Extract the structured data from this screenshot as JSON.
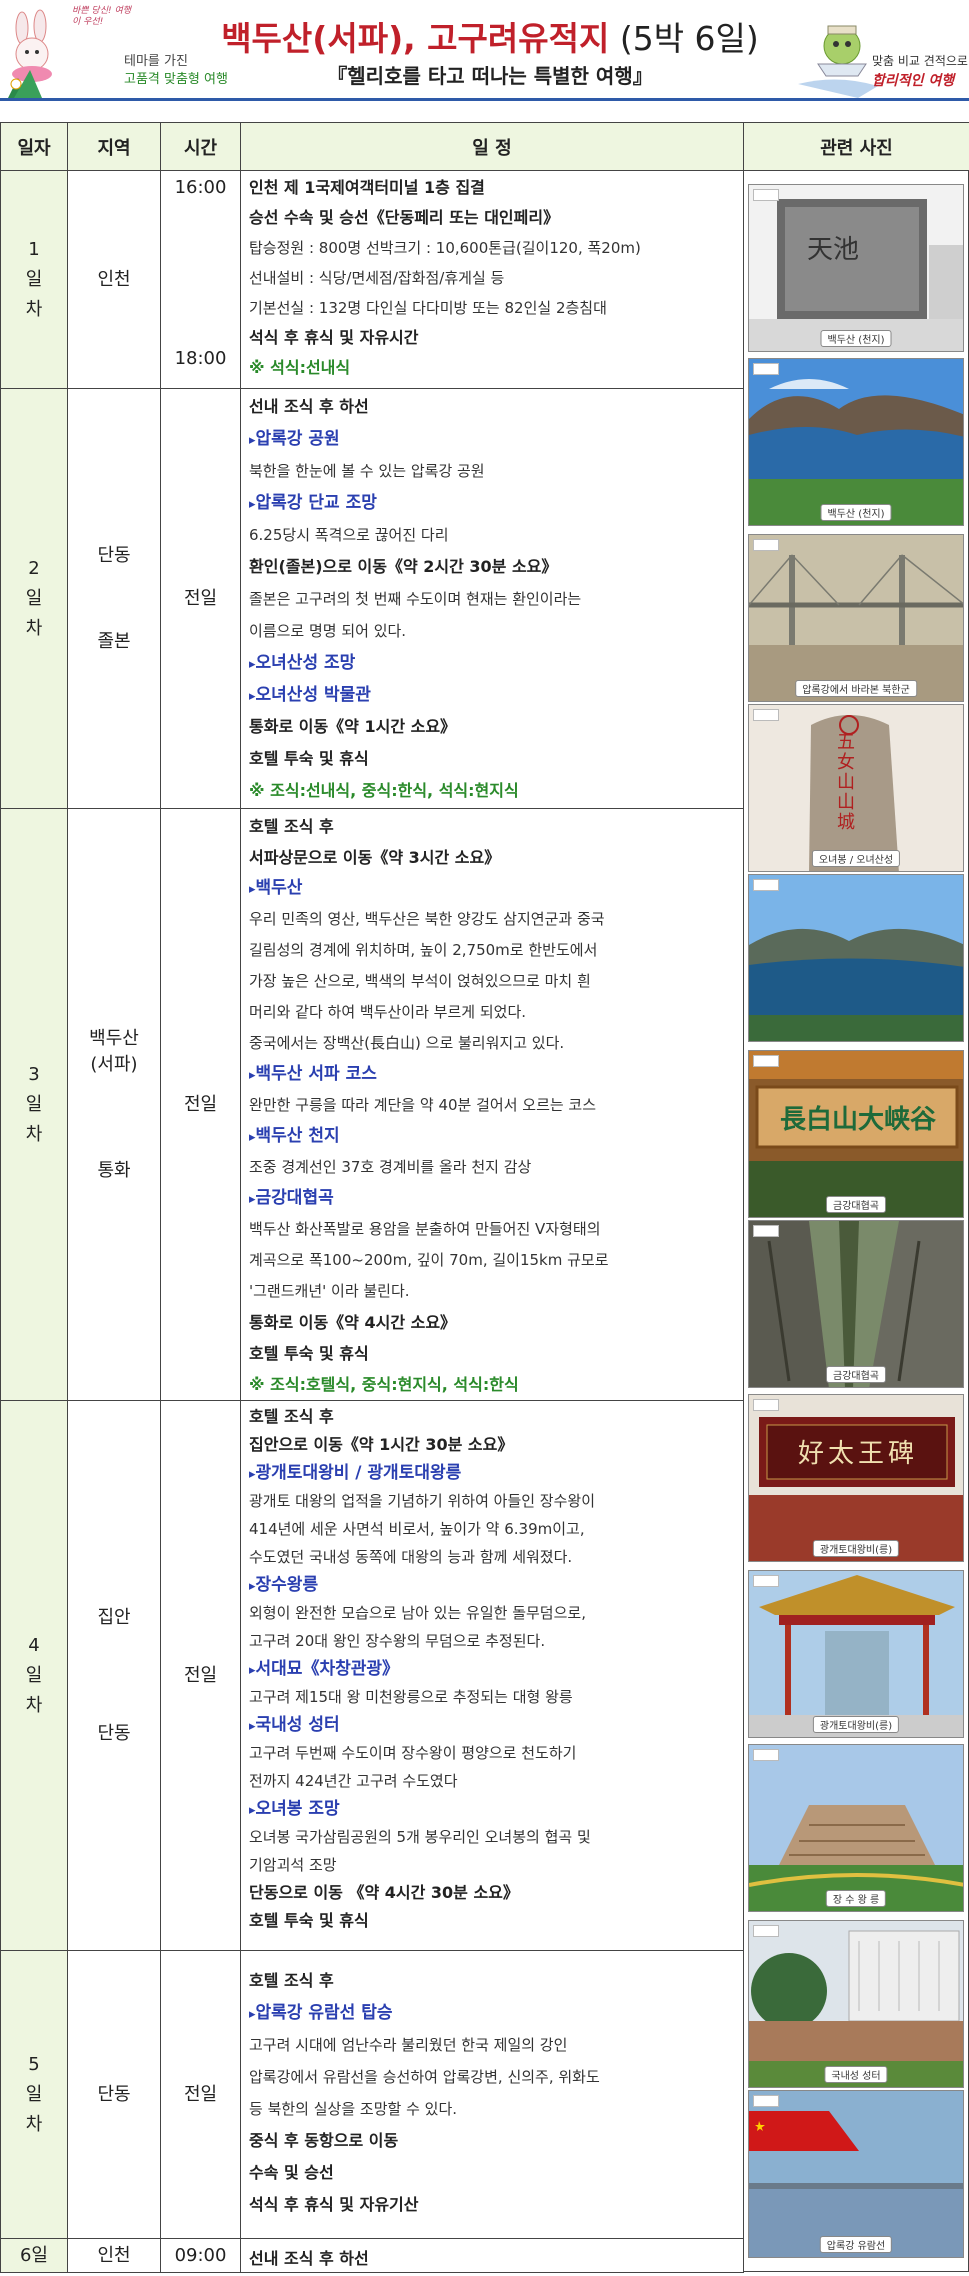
{
  "header": {
    "tagline": "바쁜 당신! 여행이 우선!",
    "left_line1": "테마를 가진",
    "left_line2": "고품격 맞춤형 여행",
    "title_red": "백두산(서파), 고구려유적지",
    "title_plain": " (5박 6일)",
    "subtitle": "『헬리호를 타고 떠나는 특별한 여행』",
    "right_line1": "맞춤 비교 견적으로",
    "right_line2": "합리적인 여행"
  },
  "columns": {
    "day": "일자",
    "region": "지역",
    "time": "시간",
    "schedule": "일          정",
    "photos": "관련 사진"
  },
  "days": [
    {
      "day": "1일차",
      "region1": "인천",
      "region2": "",
      "time1": "16:00",
      "time2": "18:00",
      "time_mid": "",
      "lines": [
        {
          "t": "b",
          "text": "인천 제 1국제여객터미널 1층 집결"
        },
        {
          "t": "b",
          "text": "승선 수속 및 승선《단동페리 또는 대인페리》"
        },
        {
          "t": "n",
          "text": "탑승정원 : 800명 선박크기 : 10,600톤급(길이120, 폭20m)"
        },
        {
          "t": "n",
          "text": "선내설비 : 식당/면세점/잡화점/휴게실 등"
        },
        {
          "t": "n",
          "text": "기본선실 : 132명 다인실 다다미방 또는 82인실 2층침대"
        },
        {
          "t": "b",
          "text": "석식 후 휴식 및 자유시간"
        },
        {
          "t": "m",
          "text": "※ 석식:선내식"
        }
      ]
    },
    {
      "day": "2일차",
      "region1": "단동",
      "region2": "졸본",
      "time1": "",
      "time2": "",
      "time_mid": "전일",
      "lines": [
        {
          "t": "b",
          "text": "선내 조식 후 하선"
        },
        {
          "t": "a",
          "text": "압록강 공원"
        },
        {
          "t": "n",
          "text": "북한을 한눈에 볼 수 있는 압록강 공원"
        },
        {
          "t": "a",
          "text": "압록강 단교 조망"
        },
        {
          "t": "n",
          "text": "6.25당시 폭격으로 끊어진 다리"
        },
        {
          "t": "b",
          "text": "환인(졸본)으로 이동《약 2시간 30분 소요》"
        },
        {
          "t": "n",
          "text": "졸본은 고구려의 첫 번째 수도이며 현재는 환인이라는"
        },
        {
          "t": "n",
          "text": "이름으로 명명 되어 있다."
        },
        {
          "t": "a",
          "text": "오녀산성 조망"
        },
        {
          "t": "a",
          "text": "오녀산성 박물관"
        },
        {
          "t": "b",
          "text": "통화로 이동《약 1시간 소요》"
        },
        {
          "t": "b",
          "text": "호텔 투숙 및 휴식"
        },
        {
          "t": "m",
          "text": "※ 조식:선내식, 중식:한식, 석식:현지식"
        }
      ]
    },
    {
      "day": "3일차",
      "region1": "백두산\n(서파)",
      "region2": "통화",
      "time1": "",
      "time2": "",
      "time_mid": "전일",
      "lines": [
        {
          "t": "b",
          "text": "호텔 조식 후"
        },
        {
          "t": "b",
          "text": "서파상문으로 이동《약 3시간 소요》"
        },
        {
          "t": "a",
          "text": "백두산"
        },
        {
          "t": "n",
          "text": "우리 민족의 영산, 백두산은 북한 양강도 삼지연군과 중국"
        },
        {
          "t": "n",
          "text": "길림성의 경계에 위치하며, 높이 2,750m로 한반도에서"
        },
        {
          "t": "n",
          "text": "가장 높은 산으로, 백색의 부석이 얹혀있으므로 마치 흰"
        },
        {
          "t": "n",
          "text": "머리와 같다 하여 백두산이라 부르게 되었다."
        },
        {
          "t": "n",
          "text": "중국에서는 장백산(長白山) 으로 불리워지고 있다."
        },
        {
          "t": "a",
          "text": "백두산 서파 코스"
        },
        {
          "t": "n",
          "text": "완만한 구릉을 따라 계단을 약 40분 걸어서 오르는 코스"
        },
        {
          "t": "a",
          "text": "백두산 천지"
        },
        {
          "t": "n",
          "text": "조중 경계선인 37호 경계비를 올라 천지 감상"
        },
        {
          "t": "a",
          "text": "금강대협곡"
        },
        {
          "t": "n",
          "text": "백두산 화산폭발로 용암을 분출하여 만들어진 V자형태의"
        },
        {
          "t": "n",
          "text": "계곡으로 폭100~200m, 깊이 70m, 길이15km 규모로"
        },
        {
          "t": "n",
          "text": "'그랜드캐년' 이라 불린다."
        },
        {
          "t": "b",
          "text": "통화로 이동《약 4시간 소요》"
        },
        {
          "t": "b",
          "text": "호텔 투숙 및 휴식"
        },
        {
          "t": "m",
          "text": "※ 조식:호텔식, 중식:현지식, 석식:한식"
        }
      ]
    },
    {
      "day": "4일차",
      "region1": "집안",
      "region2": "단동",
      "time1": "",
      "time2": "",
      "time_mid": "전일",
      "lines": [
        {
          "t": "b",
          "text": "호텔 조식 후"
        },
        {
          "t": "b",
          "text": "집안으로 이동《약 1시간 30분 소요》"
        },
        {
          "t": "a",
          "text": "광개토대왕비 / 광개토대왕릉"
        },
        {
          "t": "n",
          "text": "광개토 대왕의 업적을 기념하기 위하여 아들인 장수왕이"
        },
        {
          "t": "n",
          "text": "414년에 세운 사면석 비로서, 높이가 약 6.39m이고,"
        },
        {
          "t": "n",
          "text": "수도였던 국내성 동쪽에 대왕의 능과 함께 세워졌다."
        },
        {
          "t": "a",
          "text": "장수왕릉"
        },
        {
          "t": "n",
          "text": "외형이 완전한 모습으로 남아 있는 유일한 돌무덤으로,"
        },
        {
          "t": "n",
          "text": "고구려 20대 왕인 장수왕의 무덤으로 추정된다."
        },
        {
          "t": "a",
          "text": "서대묘《차창관광》"
        },
        {
          "t": "n",
          "text": "고구려 제15대 왕 미천왕릉으로 추정되는 대형 왕릉"
        },
        {
          "t": "a",
          "text": "국내성 성터"
        },
        {
          "t": "n",
          "text": "고구려 두번째 수도이며 장수왕이 평양으로 천도하기"
        },
        {
          "t": "n",
          "text": "전까지 424년간 고구려 수도였다"
        },
        {
          "t": "a",
          "text": "오녀봉 조망"
        },
        {
          "t": "n",
          "text": "오녀봉 국가삼림공원의 5개 봉우리인  오녀봉의 협곡 및"
        },
        {
          "t": "n",
          "text": "기암괴석 조망"
        },
        {
          "t": "b",
          "text": "단동으로 이동 《약 4시간 30분 소요》"
        },
        {
          "t": "b",
          "text": "호텔 투숙 및 휴식"
        }
      ]
    },
    {
      "day": "5일차",
      "region1": "단동",
      "region2": "",
      "time1": "",
      "time2": "",
      "time_mid": "전일",
      "lines": [
        {
          "t": "b",
          "text": "호텔 조식 후"
        },
        {
          "t": "a",
          "text": "압록강 유람선 탑승"
        },
        {
          "t": "n",
          "text": "고구려 시대에 엄난수라 불리웠던 한국 제일의 강인"
        },
        {
          "t": "n",
          "text": "압록강에서 유람선을 승선하여 압록강변, 신의주, 위화도"
        },
        {
          "t": "n",
          "text": "등 북한의 실상을 조망할 수 있다."
        },
        {
          "t": "b",
          "text": "중식 후 동항으로 이동"
        },
        {
          "t": "b",
          "text": "수속 및 승선"
        },
        {
          "t": "b",
          "text": "석식 후 휴식 및 자유기산"
        }
      ]
    },
    {
      "day": "6일",
      "region1": "인천",
      "region2": "",
      "time1": "",
      "time2": "",
      "time_mid": "09:00",
      "lines": [
        {
          "t": "b",
          "text": "선내 조식 후 하선"
        }
      ]
    }
  ],
  "photos": [
    {
      "caption": "백두산 (천지)",
      "kind": "stone",
      "stone_text": "天池"
    },
    {
      "caption": "백두산 (천지)",
      "kind": "lake"
    },
    {
      "caption": "압록강에서 바라본 북한군",
      "kind": "bridge"
    },
    {
      "caption": "오녀봉 / 오녀산성",
      "kind": "rock",
      "stone_text": "五女山山城"
    },
    {
      "caption": "",
      "kind": "lake2"
    },
    {
      "caption": "금강대협곡",
      "kind": "sign",
      "stone_text": "長白山大峡谷"
    },
    {
      "caption": "금강대협곡",
      "kind": "canyon"
    },
    {
      "caption": "광개토대왕비(릉)",
      "kind": "plaque",
      "stone_text": "好太王碑"
    },
    {
      "caption": "광개토대왕비(릉)",
      "kind": "pavilion"
    },
    {
      "caption": "장 수 왕 릉",
      "kind": "tomb"
    },
    {
      "caption": "국내성 성터",
      "kind": "wall"
    },
    {
      "caption": "압록강 유람선",
      "kind": "flag"
    }
  ],
  "colors": {
    "accent": "#c0202a",
    "header_bg": "#eef6e0",
    "link": "#2a3fb0",
    "meal": "#2a8a2a"
  }
}
